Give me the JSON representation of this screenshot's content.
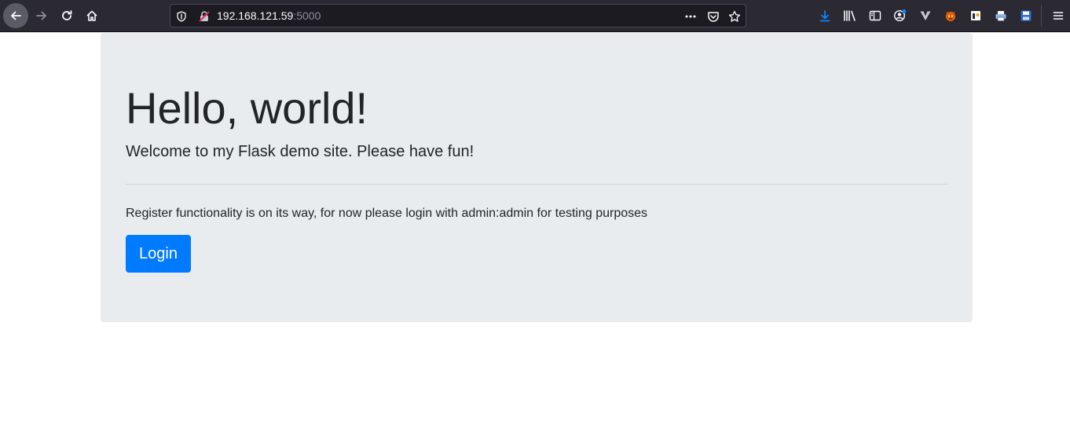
{
  "browser": {
    "url_host": "192.168.121.59",
    "url_port": ":5000",
    "accent": "#0a84ff"
  },
  "page": {
    "title": "Hello, world!",
    "lead": "Welcome to my Flask demo site. Please have fun!",
    "note": "Register functionality is on its way, for now please login with admin:admin for testing purposes",
    "login_label": "Login",
    "login_color": "#007bff",
    "panel_color": "#e9ecef"
  },
  "icons": {
    "nav": [
      "back-icon",
      "forward-icon",
      "reload-icon",
      "home-icon"
    ],
    "urlbar": [
      "tracking-protection-icon",
      "insecure-lock-icon",
      "page-actions-icon",
      "pocket-icon",
      "bookmark-star-icon"
    ],
    "toolbar": [
      "downloads-icon",
      "library-icon",
      "sidebar-icon",
      "account-icon",
      "extension-v-icon",
      "extension-fox-icon",
      "extension-dark-icon",
      "extension-print-icon",
      "extension-save-icon",
      "menu-icon"
    ]
  }
}
